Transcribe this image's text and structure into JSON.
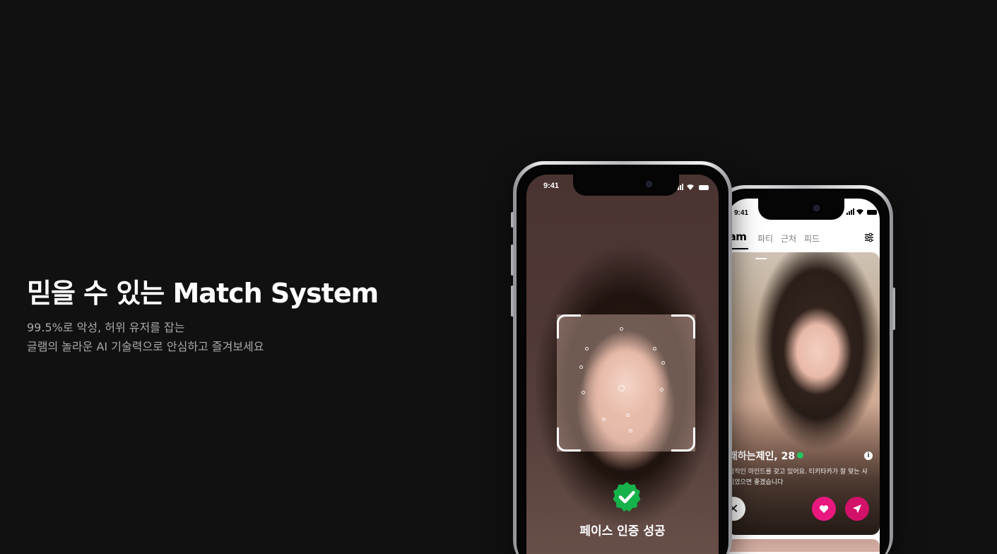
{
  "hero": {
    "title": "믿을 수 있는 Match System",
    "desc_line1": "99.5%로 악성, 허위 유저를 잡는",
    "desc_line2": "글램의 놀라운 AI 기술력으로 안심하고 즐겨보세요"
  },
  "front_phone": {
    "status_time": "9:41",
    "success_text": "페이스 인증 성공",
    "icons": [
      "face-scan-frame",
      "check-badge-icon"
    ]
  },
  "back_phone": {
    "status_time": "9:41",
    "brand": "lam",
    "tabs": [
      "파티",
      "근처",
      "피드"
    ],
    "profile": {
      "name": "래하는제인, 28",
      "bio_line1": "정적인 마인드를 갖고 있어요. 티키타카가 잘 맞는 사",
      "bio_line2": "이였으면 좋겠습니다"
    },
    "icons": [
      "filter-icon",
      "info-icon",
      "close-icon",
      "heart-icon",
      "send-icon",
      "home-icon",
      "sparkle-icon",
      "heart-outline-icon",
      "chat-icon",
      "avatar"
    ]
  },
  "colors": {
    "background": "#111111",
    "like_button": "#e8187e",
    "send_button": "#d21168",
    "verified": "#22c55e"
  }
}
